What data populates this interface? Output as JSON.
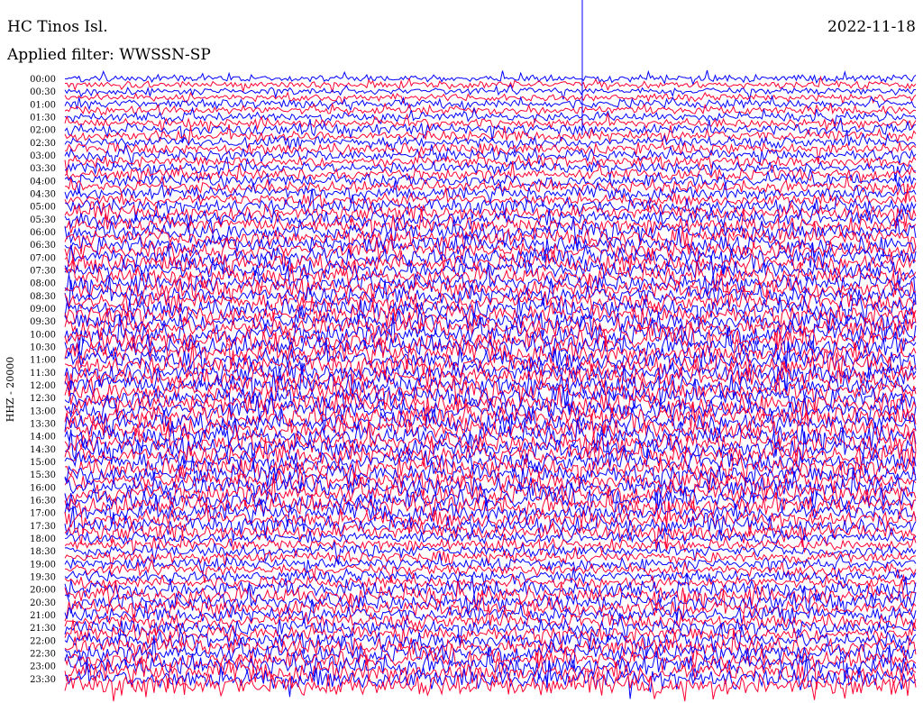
{
  "header": {
    "station": "HC Tinos Isl.",
    "filter": "Applied filter: WWSSN-SP",
    "date": "2022-11-18"
  },
  "chart_data": {
    "type": "line",
    "title": "HC Tinos Isl.",
    "subtitle": "Applied filter: WWSSN-SP",
    "date": "2022-11-18",
    "ylabel": "HHZ - 20000",
    "row_interval_minutes": 15,
    "tick_labels": [
      "00:00",
      "00:30",
      "01:00",
      "01:30",
      "02:00",
      "02:30",
      "03:00",
      "03:30",
      "04:00",
      "04:30",
      "05:00",
      "05:30",
      "06:00",
      "06:30",
      "07:00",
      "07:30",
      "08:00",
      "08:30",
      "09:00",
      "09:30",
      "10:00",
      "10:30",
      "11:00",
      "11:30",
      "12:00",
      "12:30",
      "13:00",
      "13:30",
      "14:00",
      "14:30",
      "15:00",
      "15:30",
      "16:00",
      "16:30",
      "17:00",
      "17:30",
      "18:00",
      "18:30",
      "19:00",
      "19:30",
      "20:00",
      "20:30",
      "21:00",
      "21:30",
      "22:00",
      "22:30",
      "23:00",
      "23:30"
    ],
    "trace_colors": [
      "#0000ff",
      "#ff0033"
    ],
    "relative_amplitude_by_hour": [
      0.35,
      0.45,
      0.55,
      0.55,
      0.6,
      0.75,
      0.85,
      0.9,
      0.9,
      0.95,
      1.0,
      1.0,
      1.0,
      1.0,
      1.0,
      0.95,
      0.95,
      0.85,
      0.55,
      0.55,
      0.85,
      0.75,
      0.85,
      1.0
    ],
    "grid": false
  }
}
